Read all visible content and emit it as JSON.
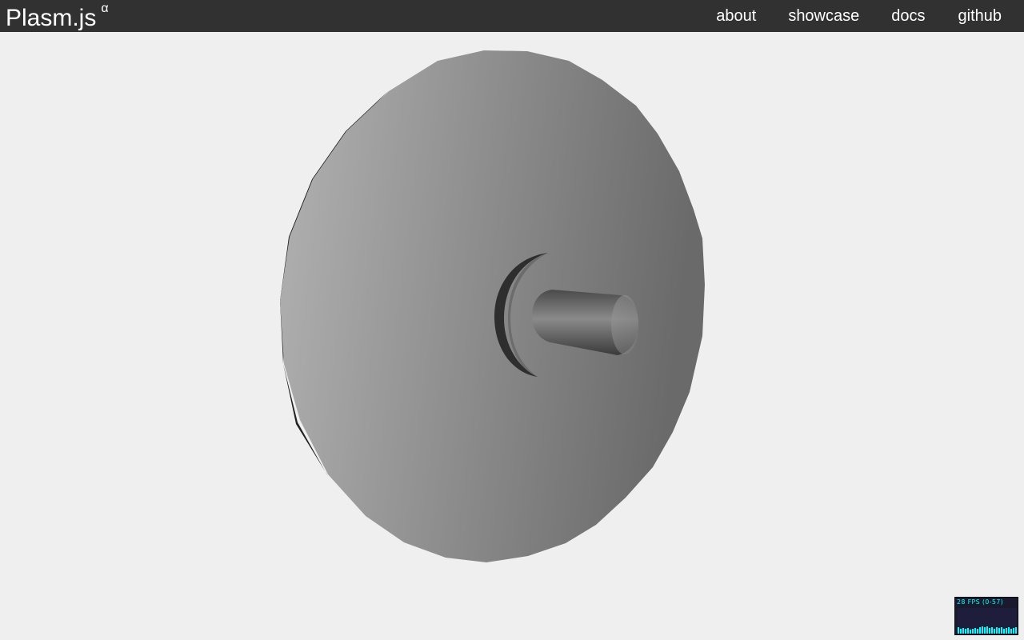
{
  "navbar": {
    "brand": "Plasm.js",
    "brand_superscript": "α",
    "links": {
      "about": "about",
      "showcase": "showcase",
      "docs": "docs",
      "github": "github"
    },
    "background": "#313131",
    "text_color": "#ffffff"
  },
  "viewport": {
    "background": "#efefef",
    "model": "disc-with-cylinder"
  },
  "stats": {
    "fps_label": "28 FPS (0-57)",
    "color": "#00ffff",
    "background": "#1a1a2e"
  }
}
